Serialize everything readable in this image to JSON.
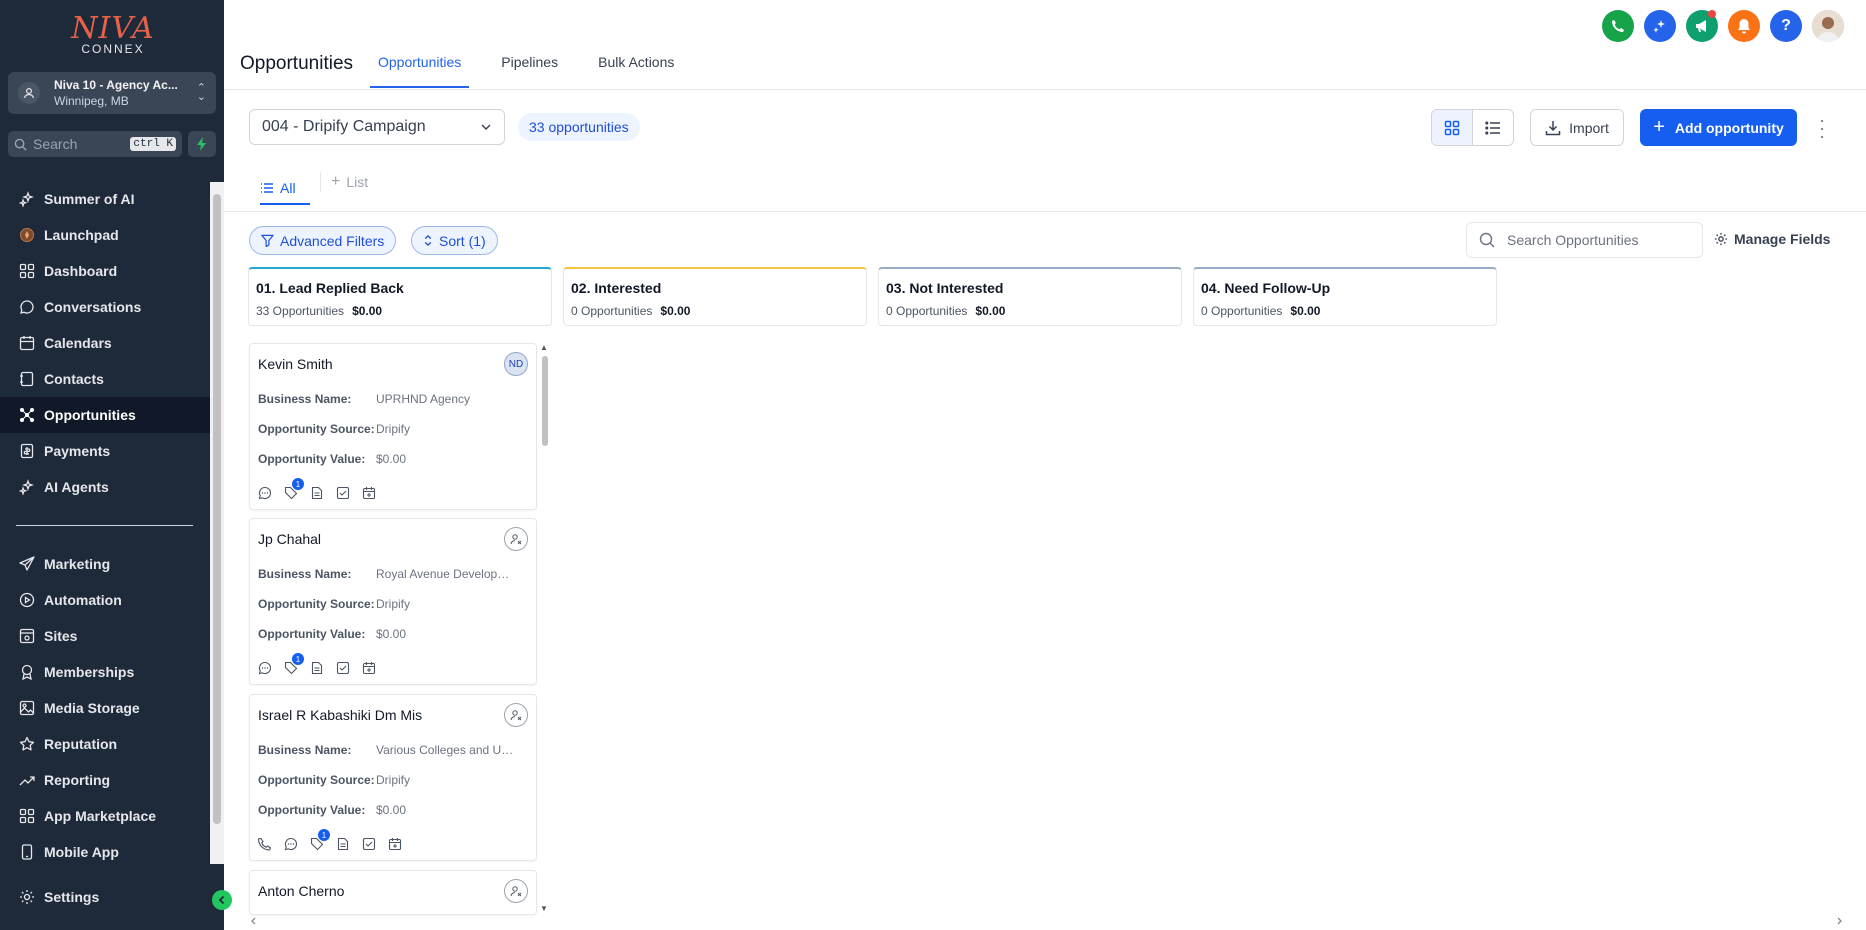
{
  "brand": {
    "line1": "NIVA",
    "line2": "CONNEX"
  },
  "account": {
    "name": "Niva 10 - Agency Ac...",
    "location": "Winnipeg, MB"
  },
  "search": {
    "placeholder": "Search",
    "shortcut": "ctrl K"
  },
  "nav": {
    "items": [
      {
        "label": "Summer of AI",
        "icon": "sparkle-icon"
      },
      {
        "label": "Launchpad",
        "icon": "rocket-icon"
      },
      {
        "label": "Dashboard",
        "icon": "dashboard-icon"
      },
      {
        "label": "Conversations",
        "icon": "chat-icon"
      },
      {
        "label": "Calendars",
        "icon": "calendar-icon"
      },
      {
        "label": "Contacts",
        "icon": "contacts-icon"
      },
      {
        "label": "Opportunities",
        "icon": "opportunities-icon",
        "active": true
      },
      {
        "label": "Payments",
        "icon": "payments-icon"
      },
      {
        "label": "AI Agents",
        "icon": "ai-agents-icon"
      }
    ],
    "items2": [
      {
        "label": "Marketing",
        "icon": "send-icon"
      },
      {
        "label": "Automation",
        "icon": "automation-icon"
      },
      {
        "label": "Sites",
        "icon": "sites-icon"
      },
      {
        "label": "Memberships",
        "icon": "membership-icon"
      },
      {
        "label": "Media Storage",
        "icon": "media-icon"
      },
      {
        "label": "Reputation",
        "icon": "star-icon"
      },
      {
        "label": "Reporting",
        "icon": "chart-icon"
      },
      {
        "label": "App Marketplace",
        "icon": "apps-icon"
      },
      {
        "label": "Mobile App",
        "icon": "mobile-icon"
      }
    ],
    "settings": "Settings"
  },
  "header": {
    "title": "Opportunities",
    "tabs": [
      "Opportunities",
      "Pipelines",
      "Bulk Actions"
    ],
    "icon_colors": {
      "phone": "#16a34a",
      "ai": "#2563eb",
      "announce": "#0e9f6e",
      "bell": "#f97316",
      "help": "#2563eb"
    }
  },
  "toolbar": {
    "pipeline": "004 - Dripify Campaign",
    "count": "33 opportunities",
    "import": "Import",
    "add": "Add opportunity"
  },
  "subtabs": {
    "all": "All",
    "list": "List"
  },
  "filters": {
    "advanced": "Advanced Filters",
    "sort": "Sort (1)",
    "search_placeholder": "Search Opportunities",
    "manage_fields": "Manage Fields"
  },
  "stages": [
    {
      "name": "01. Lead Replied Back",
      "count": "33 Opportunities",
      "value": "$0.00",
      "color": "#22a7d0"
    },
    {
      "name": "02. Interested",
      "count": "0 Opportunities",
      "value": "$0.00",
      "color": "#f5c542"
    },
    {
      "name": "03. Not Interested",
      "count": "0 Opportunities",
      "value": "$0.00",
      "color": "#9aa9c4"
    },
    {
      "name": "04. Need Follow-Up",
      "count": "0 Opportunities",
      "value": "$0.00",
      "color": "#9aa9c4"
    }
  ],
  "field_labels": {
    "business": "Business Name:",
    "source": "Opportunity Source:",
    "value": "Opportunity Value:"
  },
  "cards": [
    {
      "name": "Kevin Smith",
      "badge": "ND",
      "business": "UPRHND Agency",
      "source": "Dripify",
      "value": "$0.00",
      "tag_count": "1"
    },
    {
      "name": "Jp Chahal",
      "badge": "",
      "business": "Royal Avenue Developm...",
      "source": "Dripify",
      "value": "$0.00",
      "tag_count": "1"
    },
    {
      "name": "Israel R Kabashiki Dm Mis",
      "badge": "",
      "business": "Various Colleges and Un...",
      "source": "Dripify",
      "value": "$0.00",
      "tag_count": "1"
    },
    {
      "name": "Anton Cherno",
      "badge": ""
    }
  ]
}
